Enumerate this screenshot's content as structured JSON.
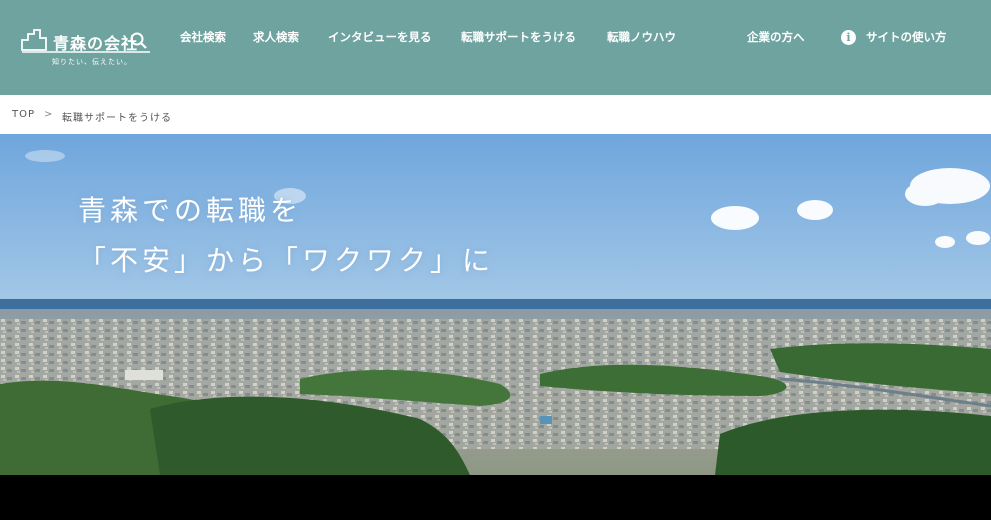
{
  "header": {
    "logo": {
      "title": "青森の会社",
      "tagline": "知りたい、伝えたい。"
    },
    "nav": [
      {
        "label": "会社検索"
      },
      {
        "label": "求人検索"
      },
      {
        "label": "インタビューを見る"
      },
      {
        "label": "転職サポートをうける"
      },
      {
        "label": "転職ノウハウ"
      },
      {
        "label": "企業の方へ"
      },
      {
        "label": "サイトの使い方",
        "icon": "info-icon"
      }
    ],
    "bg_color": "#6fa3a0"
  },
  "breadcrumb": {
    "items": [
      "TOP",
      "転職サポートをうける"
    ],
    "separator": ">"
  },
  "hero": {
    "lines": [
      "青森での転職を",
      "「不安」から「ワクワク」に"
    ]
  }
}
